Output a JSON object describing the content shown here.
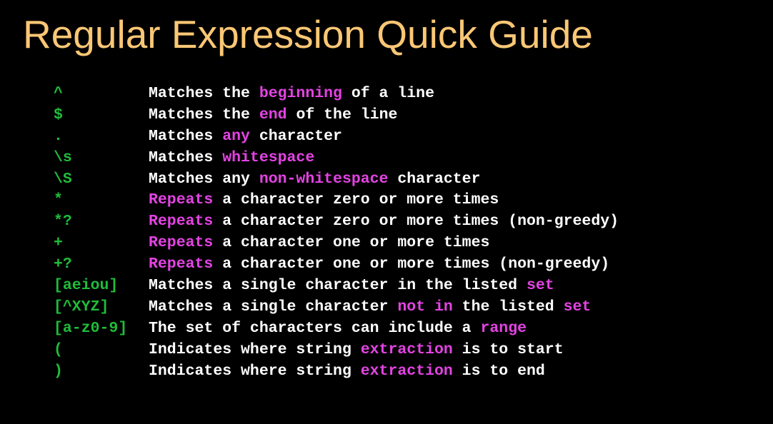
{
  "title": "Regular Expression Quick Guide",
  "colors": {
    "background": "#000000",
    "title": "#fac775",
    "symbol": "#1fbd3a",
    "text": "#ffffff",
    "highlight": "#e443e4"
  },
  "rows": [
    {
      "symbol": "^",
      "segments": [
        {
          "text": "Matches the ",
          "hl": false
        },
        {
          "text": "beginning",
          "hl": true
        },
        {
          "text": " of a line",
          "hl": false
        }
      ]
    },
    {
      "symbol": "$",
      "segments": [
        {
          "text": "Matches the ",
          "hl": false
        },
        {
          "text": "end",
          "hl": true
        },
        {
          "text": " of the line",
          "hl": false
        }
      ]
    },
    {
      "symbol": ".",
      "segments": [
        {
          "text": "Matches ",
          "hl": false
        },
        {
          "text": "any",
          "hl": true
        },
        {
          "text": " character",
          "hl": false
        }
      ]
    },
    {
      "symbol": "\\s",
      "segments": [
        {
          "text": "Matches ",
          "hl": false
        },
        {
          "text": "whitespace",
          "hl": true
        }
      ]
    },
    {
      "symbol": "\\S",
      "segments": [
        {
          "text": "Matches any ",
          "hl": false
        },
        {
          "text": "non-whitespace",
          "hl": true
        },
        {
          "text": " character",
          "hl": false
        }
      ]
    },
    {
      "symbol": "*",
      "segments": [
        {
          "text": "Repeats",
          "hl": true
        },
        {
          "text": " a character zero or more times",
          "hl": false
        }
      ]
    },
    {
      "symbol": "*?",
      "segments": [
        {
          "text": "Repeats",
          "hl": true
        },
        {
          "text": " a character zero or more times (non-greedy)",
          "hl": false
        }
      ]
    },
    {
      "symbol": "+",
      "segments": [
        {
          "text": "Repeats",
          "hl": true
        },
        {
          "text": " a character one or more times",
          "hl": false
        }
      ]
    },
    {
      "symbol": "+?",
      "segments": [
        {
          "text": "Repeats",
          "hl": true
        },
        {
          "text": " a character one or more times (non-greedy)",
          "hl": false
        }
      ]
    },
    {
      "symbol": "[aeiou]",
      "segments": [
        {
          "text": "Matches a single character in the listed ",
          "hl": false
        },
        {
          "text": "set",
          "hl": true
        }
      ]
    },
    {
      "symbol": "[^XYZ]",
      "segments": [
        {
          "text": "Matches a single character ",
          "hl": false
        },
        {
          "text": "not in",
          "hl": true
        },
        {
          "text": " the listed ",
          "hl": false
        },
        {
          "text": "set",
          "hl": true
        }
      ]
    },
    {
      "symbol": "[a-z0-9]",
      "segments": [
        {
          "text": "The set of characters can include a ",
          "hl": false
        },
        {
          "text": "range",
          "hl": true
        }
      ]
    },
    {
      "symbol": "(",
      "segments": [
        {
          "text": "Indicates where string ",
          "hl": false
        },
        {
          "text": "extraction",
          "hl": true
        },
        {
          "text": " is to start",
          "hl": false
        }
      ]
    },
    {
      "symbol": ")",
      "segments": [
        {
          "text": "Indicates where string ",
          "hl": false
        },
        {
          "text": "extraction",
          "hl": true
        },
        {
          "text": " is to end",
          "hl": false
        }
      ]
    }
  ]
}
